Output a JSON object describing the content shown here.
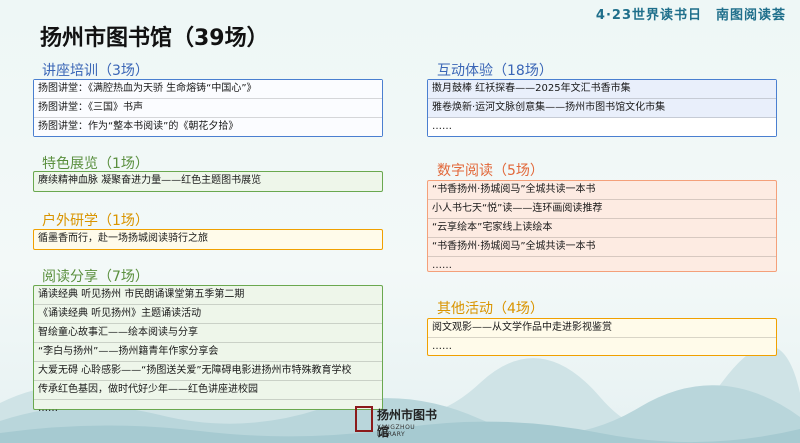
{
  "banner": "4·23世界读书日　南图阅读荟",
  "title": "扬州市图书馆（39场）",
  "sections": {
    "lecture": {
      "title": "讲座培训（3场）",
      "color": "#4a7fd0",
      "items": [
        "扬图讲堂：《满腔热血为天骄 生命熔铸“中国心”》",
        "扬图讲堂：《三国》书声",
        "扬图讲堂：作为“整本书阅读”的《朝花夕拾》"
      ]
    },
    "exhibition": {
      "title": "特色展览（1场）",
      "color": "#6aa84f",
      "items": [
        "赓续精神血脉 凝聚奋进力量——红色主题图书展览"
      ]
    },
    "outdoor": {
      "title": "户外研学（1场）",
      "color": "#f0a000",
      "items": [
        "循墨香而行，赴一场扬城阅读骑行之旅"
      ]
    },
    "reading_share": {
      "title": "阅读分享（7场）",
      "color": "#6aa84f",
      "items": [
        "诵读经典 听见扬州 市民朗诵课堂第五季第二期",
        "《诵读经典 听见扬州》主题诵读活动",
        "智绘童心故事汇——绘本阅读与分享",
        "“李白与扬州”——扬州籍青年作家分享会",
        "大爱无碍  心聆感影——“扬图送关爱”无障碍电影进扬州市特殊教育学校",
        "传承红色基因，做时代好少年——红色讲座进校园",
        "……"
      ]
    },
    "interactive": {
      "title": "互动体验（18场）",
      "color": "#4a7fd0",
      "items": [
        "擞月鼓棒 红袄探春——2025年文汇书香市集",
        "雅卷焕新·运河文脉创意集——扬州市图书馆文化市集",
        "……"
      ]
    },
    "digital": {
      "title": "数字阅读（5场）",
      "color": "#f4a07a",
      "items": [
        "“书香扬州·扬城阅马”全城共读一本书",
        "小人书七天“悦”读——连环画阅读推荐",
        "“云享绘本”宅家线上读绘本",
        "“书香扬州·扬城阅马”全城共读一本书",
        "……"
      ]
    },
    "other": {
      "title": "其他活动（4场）",
      "color": "#f0a000",
      "items": [
        "阅文观影——从文学作品中走进影视鉴赏",
        "……"
      ]
    }
  },
  "logo": {
    "name": "扬州市图书馆",
    "sub": "YANGZHOU LIBRARY"
  }
}
